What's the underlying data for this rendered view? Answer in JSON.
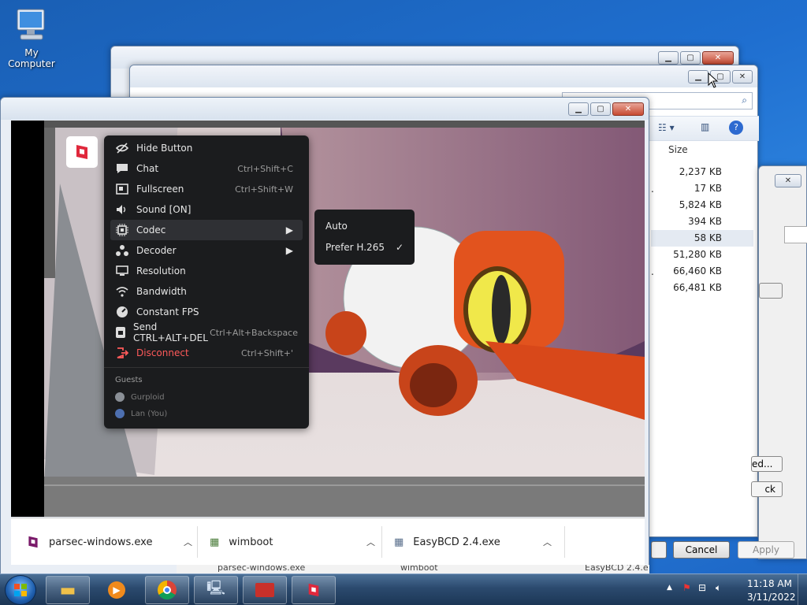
{
  "desktop": {
    "my_computer": "My Computer"
  },
  "explorer": {
    "size_header": "Size",
    "sizes": [
      "2,237 KB",
      "17 KB",
      "5,824 KB",
      "394 KB",
      "58 KB",
      "51,280 KB",
      "66,460 KB",
      "66,481 KB"
    ],
    "frag_row2": ".",
    "frag_row7": "."
  },
  "dialog": {
    "button_ed": "ed...",
    "button_ck": "ck",
    "cancel": "Cancel",
    "apply": "Apply"
  },
  "parsec_menu": {
    "items": [
      {
        "label": "Hide Button",
        "shortcut": ""
      },
      {
        "label": "Chat",
        "shortcut": "Ctrl+Shift+C"
      },
      {
        "label": "Fullscreen",
        "shortcut": "Ctrl+Shift+W"
      },
      {
        "label": "Sound [ON]",
        "shortcut": ""
      },
      {
        "label": "Codec",
        "shortcut": ""
      },
      {
        "label": "Decoder",
        "shortcut": ""
      },
      {
        "label": "Resolution",
        "shortcut": ""
      },
      {
        "label": "Bandwidth",
        "shortcut": ""
      },
      {
        "label": "Constant FPS",
        "shortcut": ""
      },
      {
        "label": "Send CTRL+ALT+DEL",
        "shortcut": "Ctrl+Alt+Backspace"
      },
      {
        "label": "Disconnect",
        "shortcut": "Ctrl+Shift+'"
      }
    ],
    "guests_header": "Guests",
    "guests": [
      "Gurploid",
      "Lan (You)"
    ],
    "codec_submenu": [
      "Auto",
      "Prefer H.265"
    ]
  },
  "downloads": [
    {
      "name": "parsec-windows.exe"
    },
    {
      "name": "wimboot"
    },
    {
      "name": "EasyBCD 2.4.exe"
    }
  ],
  "background_downloads": [
    "parsec-windows.exe",
    "wimboot",
    "EasyBCD 2.4.e"
  ],
  "clock": {
    "time": "11:18 AM",
    "date": "3/11/2022"
  },
  "colors": {
    "accent_red": "#ff5a5a",
    "parsec_red": "#e0283c",
    "menu_bg": "#1b1c1e"
  }
}
